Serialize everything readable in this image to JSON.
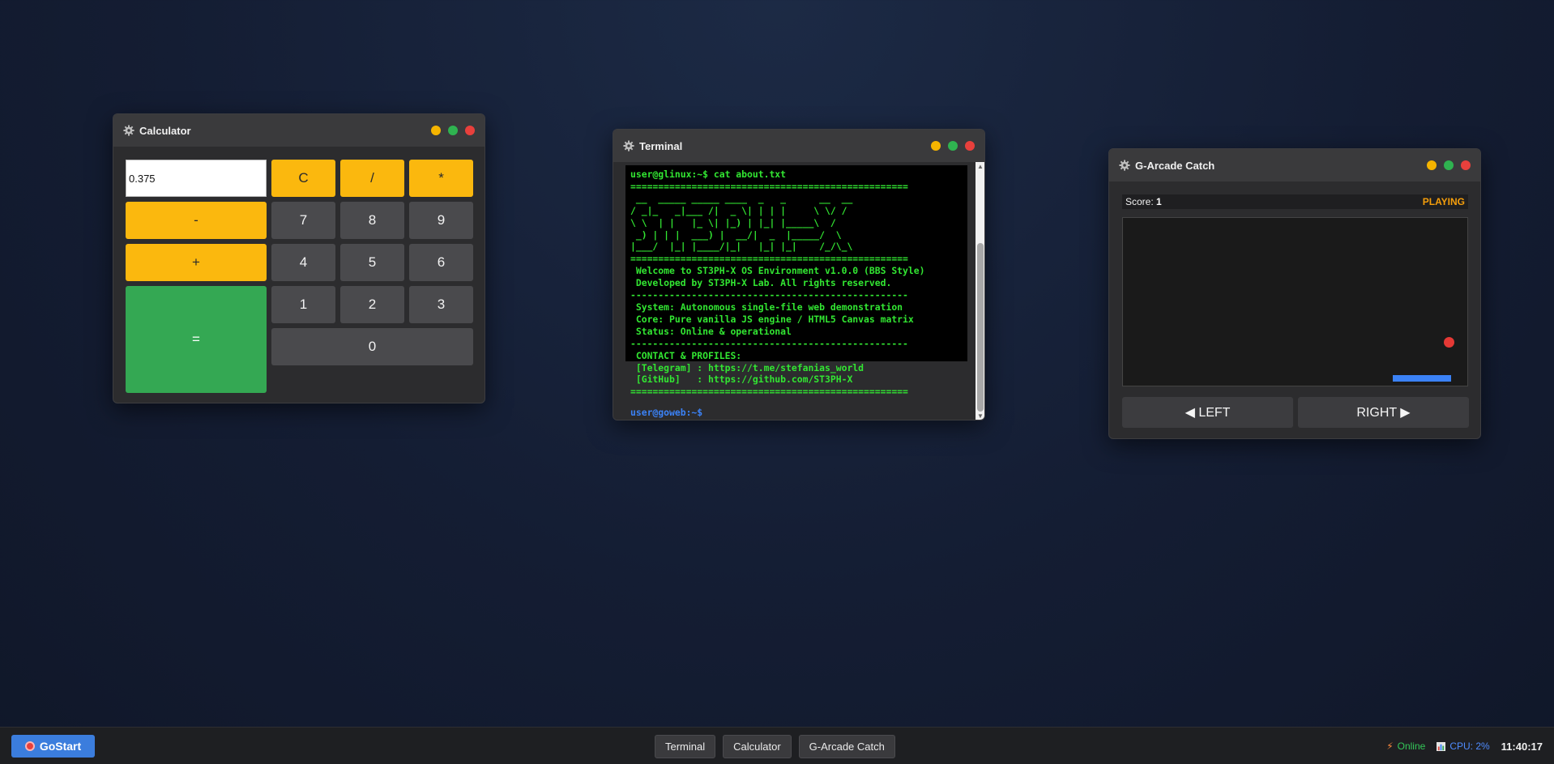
{
  "windows": {
    "calculator": {
      "title": "Calculator",
      "display_value": "0.375",
      "keys": {
        "clear": "C",
        "divide": "/",
        "multiply": "*",
        "minus": "-",
        "plus": "+",
        "equals": "=",
        "d7": "7",
        "d8": "8",
        "d9": "9",
        "d4": "4",
        "d5": "5",
        "d6": "6",
        "d1": "1",
        "d2": "2",
        "d3": "3",
        "d0": "0"
      }
    },
    "terminal": {
      "title": "Terminal",
      "output": "user@glinux:~$ cat about.txt\n==================================================\n __  _____ _____ ____  _   _      __  __\n/ _|_   _|___ /|  _ \\| | | |     \\ \\/ /\n\\ \\  | |   |_ \\| |_) | |_| |_____\\  / \n _) | | |  ___) |  __/|  _  |_____/  \\ \n|___/  |_| |____/|_|   |_| |_|    /_/\\_\\\n==================================================\n Welcome to ST3PH-X OS Environment v1.0.0 (BBS Style)\n Developed by ST3PH-X Lab. All rights reserved.\n--------------------------------------------------\n System: Autonomous single-file web demonstration\n Core: Pure vanilla JS engine / HTML5 Canvas matrix\n Status: Online & operational\n--------------------------------------------------\n CONTACT & PROFILES:\n [Telegram] : https://t.me/stefanias_world\n [GitHub]   : https://github.com/ST3PH-X\n==================================================",
      "prompt": "user@goweb:~$"
    },
    "game": {
      "title": "G-Arcade Catch",
      "score_label": "Score:",
      "score_value": "1",
      "status": "PLAYING",
      "left_button": "◀ LEFT",
      "right_button": "RIGHT ▶"
    }
  },
  "taskbar": {
    "start_label": "GoStart",
    "apps": [
      "Terminal",
      "Calculator",
      "G-Arcade Catch"
    ],
    "network_status": "Online",
    "cpu_label": "CPU: 2%",
    "clock": "11:40:17"
  },
  "colors": {
    "accent_yellow": "#fbb80e",
    "accent_green": "#34a853",
    "accent_blue": "#3b82f6",
    "close_red": "#e8403c",
    "terminal_green": "#32e632"
  },
  "icons": [
    "gear-icon",
    "bolt-icon",
    "cpu-chart-icon",
    "scroll-up-icon",
    "scroll-down-icon"
  ]
}
